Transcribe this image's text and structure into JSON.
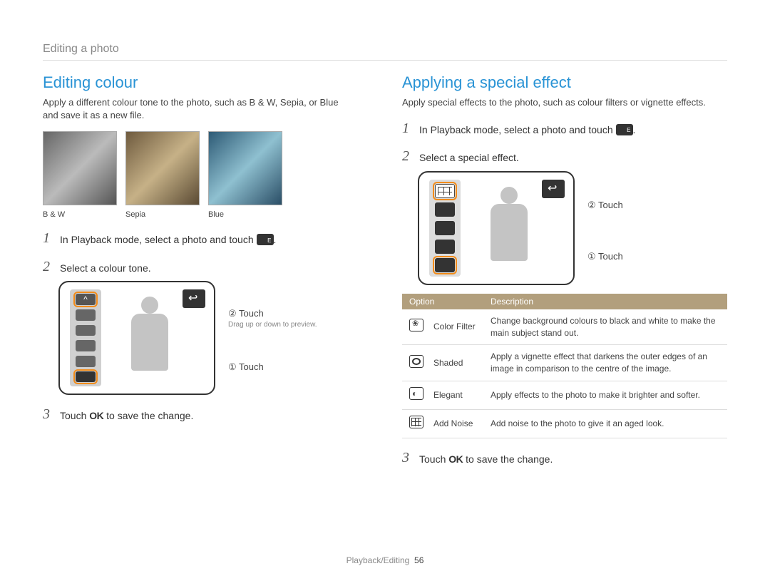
{
  "breadcrumb": "Editing a photo",
  "left": {
    "heading": "Editing colour",
    "intro": "Apply a different colour tone to the photo, such as B & W, Sepia, or Blue and save it as a new file.",
    "samples": {
      "bw": "B & W",
      "sepia": "Sepia",
      "blue": "Blue"
    },
    "step1_before": "In Playback mode, select a photo and touch ",
    "step1_after": ".",
    "step2": "Select a colour tone.",
    "step3_before": "Touch ",
    "step3_ok": "OK",
    "step3_after": " to save the change.",
    "callout2": "② Touch",
    "callout2_note": "Drag up or down to preview.",
    "callout1": "① Touch"
  },
  "right": {
    "heading": "Applying a special effect",
    "intro": "Apply special effects to the photo, such as colour filters or vignette effects.",
    "step1_before": "In Playback mode, select a photo and touch ",
    "step1_after": ".",
    "step2": "Select a special effect.",
    "step3_before": "Touch ",
    "step3_ok": "OK",
    "step3_after": " to save the change.",
    "callout2": "② Touch",
    "callout1": "① Touch",
    "table": {
      "header1": "Option",
      "header2": "Description",
      "rows": [
        {
          "name": "Color Filter",
          "desc": "Change background colours to black and white to make the main subject stand out."
        },
        {
          "name": "Shaded",
          "desc": "Apply a vignette effect that darkens the outer edges of an image in comparison to the centre of the image."
        },
        {
          "name": "Elegant",
          "desc": "Apply effects to the photo to make it brighter and softer."
        },
        {
          "name": "Add Noise",
          "desc": "Add noise to the photo to give it an aged look."
        }
      ]
    }
  },
  "footer": {
    "section": "Playback/Editing",
    "page": "56"
  }
}
